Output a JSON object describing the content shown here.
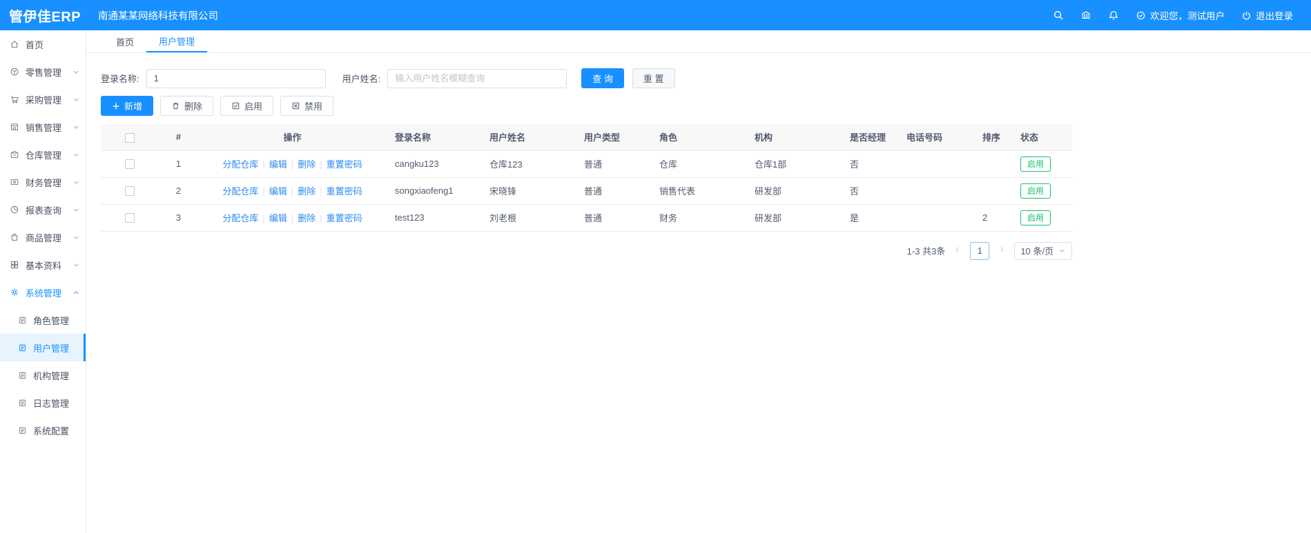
{
  "app": {
    "logo": "管伊佳ERP",
    "company": "南通某某网络科技有限公司",
    "welcome": "欢迎您，测试用户",
    "logout": "退出登录"
  },
  "sidebar": {
    "items": [
      {
        "key": "home",
        "label": "首页",
        "icon": "home"
      },
      {
        "key": "retail",
        "label": "零售管理",
        "icon": "retail",
        "chevron": "down"
      },
      {
        "key": "purchase",
        "label": "采购管理",
        "icon": "purchase",
        "chevron": "down"
      },
      {
        "key": "sales",
        "label": "销售管理",
        "icon": "sales",
        "chevron": "down"
      },
      {
        "key": "warehouse",
        "label": "仓库管理",
        "icon": "warehouse",
        "chevron": "down"
      },
      {
        "key": "finance",
        "label": "财务管理",
        "icon": "finance",
        "chevron": "down"
      },
      {
        "key": "report",
        "label": "报表查询",
        "icon": "report",
        "chevron": "down"
      },
      {
        "key": "product",
        "label": "商品管理",
        "icon": "product",
        "chevron": "down"
      },
      {
        "key": "basic",
        "label": "基本资料",
        "icon": "basic",
        "chevron": "down"
      },
      {
        "key": "system",
        "label": "系统管理",
        "icon": "system",
        "chevron": "up",
        "active": true
      }
    ],
    "subitems": [
      {
        "key": "role",
        "label": "角色管理"
      },
      {
        "key": "user",
        "label": "用户管理",
        "active": true
      },
      {
        "key": "org",
        "label": "机构管理"
      },
      {
        "key": "log",
        "label": "日志管理"
      },
      {
        "key": "config",
        "label": "系统配置"
      }
    ]
  },
  "tabs": [
    {
      "key": "home",
      "label": "首页"
    },
    {
      "key": "user-management",
      "label": "用户管理",
      "active": true
    }
  ],
  "search": {
    "login_label": "登录名称:",
    "login_value": "1",
    "name_label": "用户姓名:",
    "name_placeholder": "输入用户姓名模糊查询",
    "query_label": "查 询",
    "reset_label": "重 置"
  },
  "toolbar": {
    "add": "新增",
    "delete": "删除",
    "enable": "启用",
    "disable": "禁用"
  },
  "table": {
    "headers": [
      "#",
      "操作",
      "登录名称",
      "用户姓名",
      "用户类型",
      "角色",
      "机构",
      "是否经理",
      "电话号码",
      "排序",
      "状态"
    ],
    "action_links": [
      {
        "key": "assign-warehouse",
        "label": "分配仓库"
      },
      {
        "key": "edit",
        "label": "编辑"
      },
      {
        "key": "delete",
        "label": "删除"
      },
      {
        "key": "reset-password",
        "label": "重置密码"
      }
    ],
    "separator": "|",
    "rows": [
      {
        "index": "1",
        "login": "cangku123",
        "name": "仓库123",
        "type": "普通",
        "role": "仓库",
        "org": "仓库1部",
        "manager": "否",
        "phone": "",
        "sort": "",
        "status": "启用"
      },
      {
        "index": "2",
        "login": "songxiaofeng1",
        "name": "宋晓锋",
        "type": "普通",
        "role": "销售代表",
        "org": "研发部",
        "manager": "否",
        "phone": "",
        "sort": "",
        "status": "启用"
      },
      {
        "index": "3",
        "login": "test123",
        "name": "刘老根",
        "type": "普通",
        "role": "财务",
        "org": "研发部",
        "manager": "是",
        "phone": "",
        "sort": "2",
        "status": "启用"
      }
    ]
  },
  "pagination": {
    "total": "1-3 共3条",
    "page": "1",
    "page_size": "10 条/页"
  },
  "colors": {
    "primary": "#1890ff",
    "success": "#19be6b"
  }
}
